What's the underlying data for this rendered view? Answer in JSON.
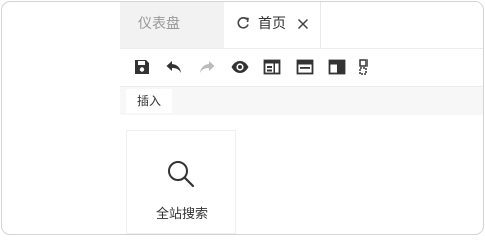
{
  "tabs": [
    {
      "label": "仪表盘",
      "active": false
    },
    {
      "label": "首页",
      "active": true
    }
  ],
  "toolbar": {
    "icons": [
      "save-icon",
      "undo-icon",
      "redo-icon",
      "preview-icon",
      "layout-split-icon",
      "layout-top-icon",
      "layout-header-icon",
      "grid-icon"
    ]
  },
  "subbar": {
    "insert_label": "插入"
  },
  "widget": {
    "caption": "全站搜索",
    "icon": "search-icon"
  },
  "colors": {
    "inactive_tab_bg": "#f2f2f2",
    "icon_dark": "#333333",
    "icon_disabled": "#bbbbbb"
  }
}
